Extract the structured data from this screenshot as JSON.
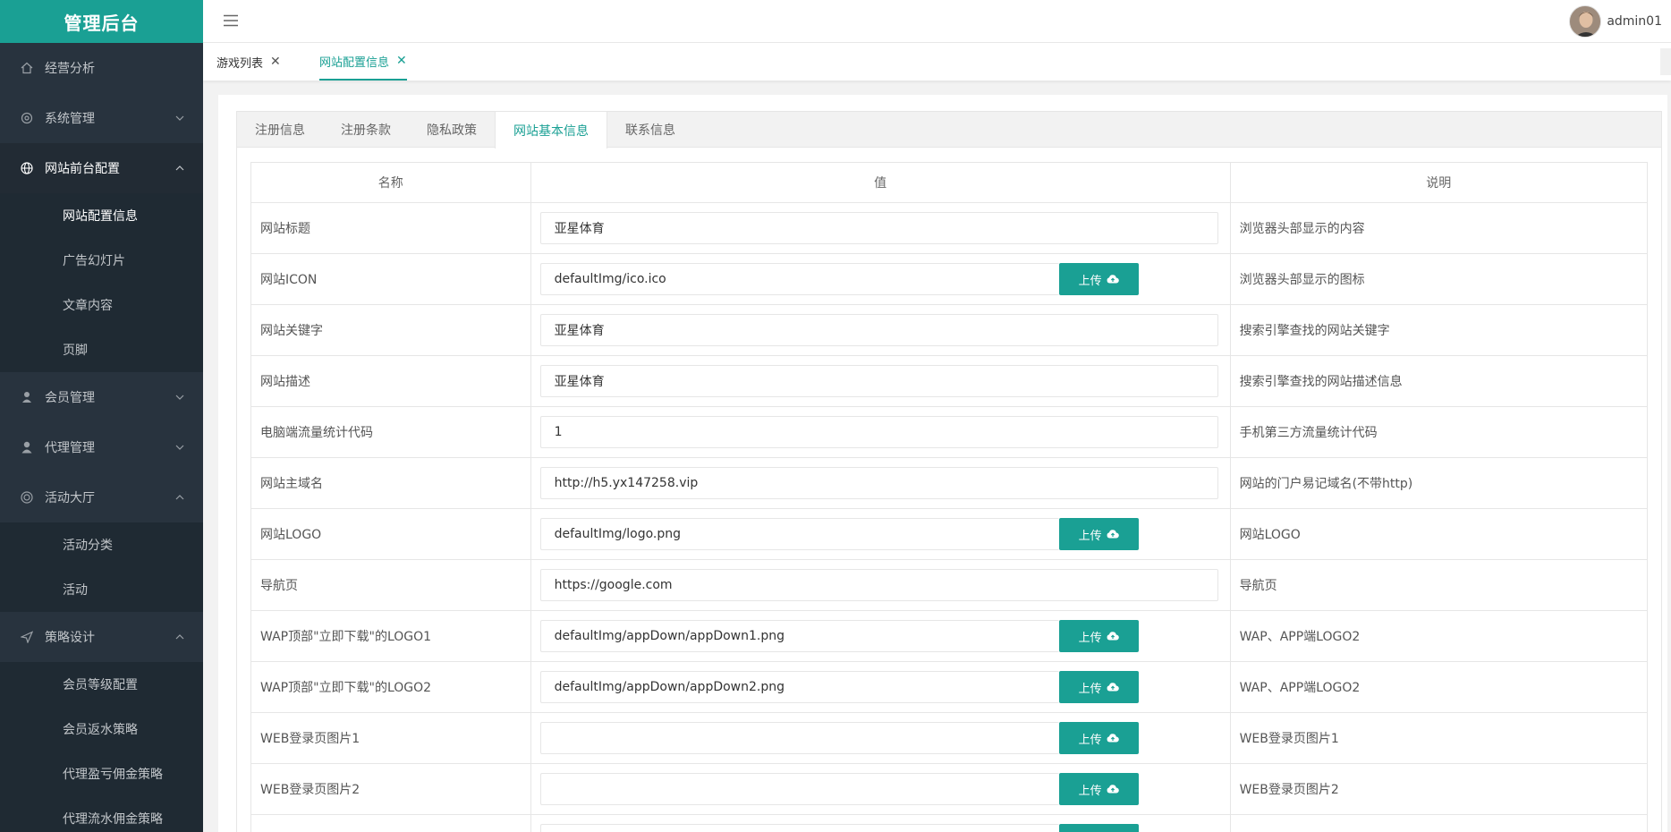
{
  "app": {
    "title": "管理后台"
  },
  "user": {
    "name": "admin01"
  },
  "sidebar": {
    "items": [
      {
        "label": "经营分析"
      },
      {
        "label": "系统管理"
      },
      {
        "label": "网站前台配置"
      },
      {
        "label": "会员管理"
      },
      {
        "label": "代理管理"
      },
      {
        "label": "活动大厅"
      },
      {
        "label": "策略设计"
      }
    ],
    "sub_site": [
      "网站配置信息",
      "广告幻灯片",
      "文章内容",
      "页脚"
    ],
    "sub_activity": [
      "活动分类",
      "活动"
    ],
    "sub_strategy": [
      "会员等级配置",
      "会员返水策略",
      "代理盈亏佣金策略",
      "代理流水佣金策略"
    ]
  },
  "page_tabs": [
    {
      "label": "游戏列表"
    },
    {
      "label": "网站配置信息"
    }
  ],
  "content_tabs": [
    "注册信息",
    "注册条款",
    "隐私政策",
    "网站基本信息",
    "联系信息"
  ],
  "table": {
    "headers": [
      "名称",
      "值",
      "说明"
    ],
    "upload_label": "上传",
    "rows": [
      {
        "name": "网站标题",
        "value": "亚星体育",
        "desc": "浏览器头部显示的内容"
      },
      {
        "name": "网站ICON",
        "value": "defaultImg/ico.ico",
        "desc": "浏览器头部显示的图标"
      },
      {
        "name": "网站关键字",
        "value": "亚星体育",
        "desc": "搜索引擎查找的网站关键字"
      },
      {
        "name": "网站描述",
        "value": "亚星体育",
        "desc": "搜索引擎查找的网站描述信息"
      },
      {
        "name": "电脑端流量统计代码",
        "value": "1",
        "desc": "手机第三方流量统计代码"
      },
      {
        "name": "网站主域名",
        "value": "http://h5.yx147258.vip",
        "desc": "网站的门户易记域名(不带http)"
      },
      {
        "name": "网站LOGO",
        "value": "defaultImg/logo.png",
        "desc": "网站LOGO"
      },
      {
        "name": "导航页",
        "value": "https://google.com",
        "desc": "导航页"
      },
      {
        "name": "WAP顶部\"立即下载\"的LOGO1",
        "value": "defaultImg/appDown/appDown1.png",
        "desc": "WAP、APP端LOGO2"
      },
      {
        "name": "WAP顶部\"立即下载\"的LOGO2",
        "value": "defaultImg/appDown/appDown2.png",
        "desc": "WAP、APP端LOGO2"
      },
      {
        "name": "WEB登录页图片1",
        "value": "",
        "desc": "WEB登录页图片1"
      },
      {
        "name": "WEB登录页图片2",
        "value": "",
        "desc": "WEB登录页图片2"
      },
      {
        "name": "",
        "value": "",
        "desc": ""
      }
    ]
  },
  "colors": {
    "accent": "#1aa094",
    "sidebar_bg": "#28333e"
  }
}
